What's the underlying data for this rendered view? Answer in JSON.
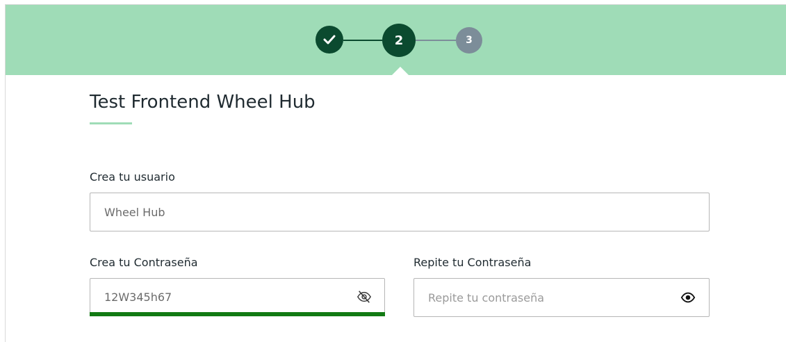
{
  "stepper": {
    "steps": [
      {
        "label": "",
        "state": "completed",
        "icon": "check-icon"
      },
      {
        "label": "2",
        "state": "active"
      },
      {
        "label": "3",
        "state": "pending"
      }
    ],
    "colors": {
      "header_bg": "#9fdcb7",
      "active": "#0b4a2f",
      "pending": "#7c8d99"
    }
  },
  "form": {
    "title": "Test Frontend Wheel Hub",
    "username": {
      "label": "Crea tu usuario",
      "value": "Wheel Hub"
    },
    "password": {
      "label": "Crea tu Contraseña",
      "value": "12W345h67",
      "toggle_icon": "eye-off-icon",
      "strength_color": "#127a13"
    },
    "repeat_password": {
      "label": "Repite tu Contraseña",
      "value": "",
      "placeholder": "Repite tu contraseña",
      "toggle_icon": "eye-icon"
    }
  }
}
